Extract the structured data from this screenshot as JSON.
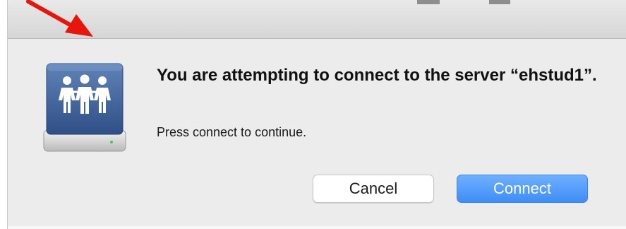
{
  "dialog": {
    "heading": "You are attempting to connect to the server “ehstud1”.",
    "message": "Press connect to continue.",
    "icon": "server-people-icon"
  },
  "buttons": {
    "cancel_label": "Cancel",
    "connect_label": "Connect"
  },
  "annotation": {
    "icon": "red-arrow-icon",
    "color": "#e8150c"
  },
  "colors": {
    "accent": "#4a97fb",
    "dialog_bg": "#ececec",
    "titlebar": "#dcdcdc"
  }
}
